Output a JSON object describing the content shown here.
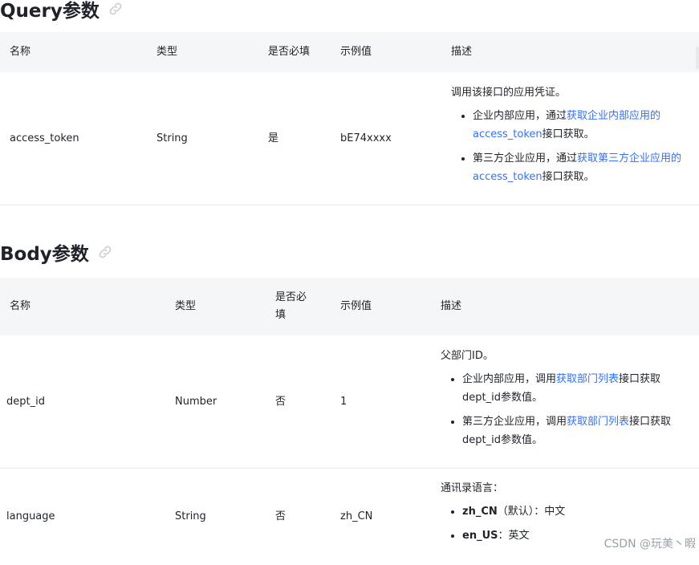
{
  "query": {
    "title": "Query参数",
    "headers": [
      "名称",
      "类型",
      "是否必填",
      "示例值",
      "描述"
    ],
    "row": {
      "name": "access_token",
      "type": "String",
      "required": "是",
      "example": "bE74xxxx",
      "desc_intro": "调用该接口的应用凭证。",
      "item1_pre": "企业内部应用，通过",
      "item1_link": "获取企业内部应用的access_token",
      "item1_post": "接口获取。",
      "item2_pre": "第三方企业应用，通过",
      "item2_link": "获取第三方企业应用的access_token",
      "item2_post": "接口获取。"
    }
  },
  "body": {
    "title": "Body参数",
    "headers": [
      "名称",
      "类型",
      "是否必填",
      "示例值",
      "描述"
    ],
    "rows": [
      {
        "name": "dept_id",
        "type": "Number",
        "required": "否",
        "example": "1",
        "desc_intro": "父部门ID。",
        "item1_pre": "企业内部应用，调用",
        "item1_link": "获取部门列表",
        "item1_post": "接口获取dept_id参数值。",
        "item2_pre": "第三方企业应用，调用",
        "item2_link": "获取部门列表",
        "item2_post": "接口获取dept_id参数值。"
      },
      {
        "name": "language",
        "type": "String",
        "required": "否",
        "example": "zh_CN",
        "desc_intro": "通讯录语言：",
        "item1_code": "zh_CN",
        "item1_text": "（默认）：中文",
        "item2_code": "en_US",
        "item2_text": "：英文"
      }
    ]
  },
  "watermark": "CSDN @玩美丶暇",
  "colors": {
    "link": "#3370ff",
    "header_bg": "#f5f6f7",
    "divider": "#e8e9eb"
  }
}
